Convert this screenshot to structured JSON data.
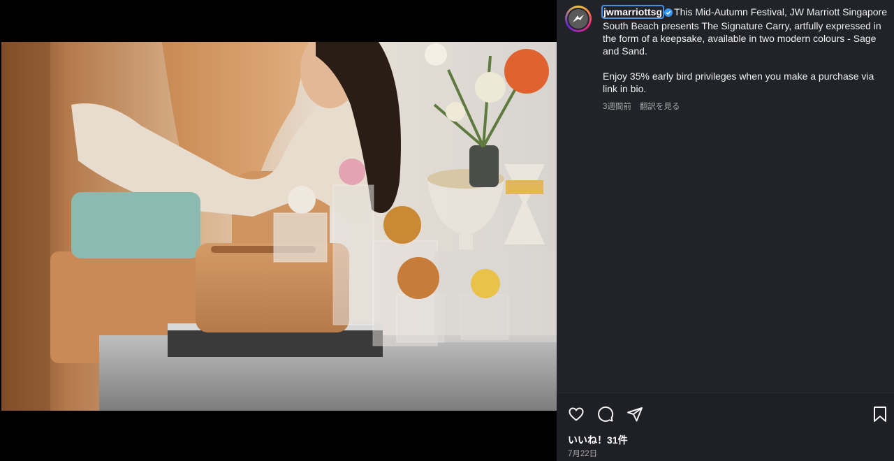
{
  "post": {
    "username": "jwmarriottsg",
    "caption_line1": "This Mid-Autumn Festival, JW Marriott Singapore South Beach presents The Signature Carry, artfully expressed in the form of a keepsake, available in two modern colours - Sage and Sand.",
    "caption_line2": "Enjoy 35% early bird privileges when you make a purchase via link in bio.",
    "time_ago": "3週間前",
    "translate_label": "翻訳を見る",
    "likes": "いいね！31件",
    "date": "7月22日"
  },
  "icons": {
    "verified": "verified-badge-icon",
    "like": "heart-icon",
    "comment": "comment-icon",
    "share": "send-icon",
    "save": "bookmark-icon",
    "avatar": "jw-marriott-logo"
  },
  "colors": {
    "panel_bg": "#212328",
    "verified_blue": "#3897f0",
    "username_outline": "#4a90e2",
    "secondary_text": "#a8a8a8"
  }
}
